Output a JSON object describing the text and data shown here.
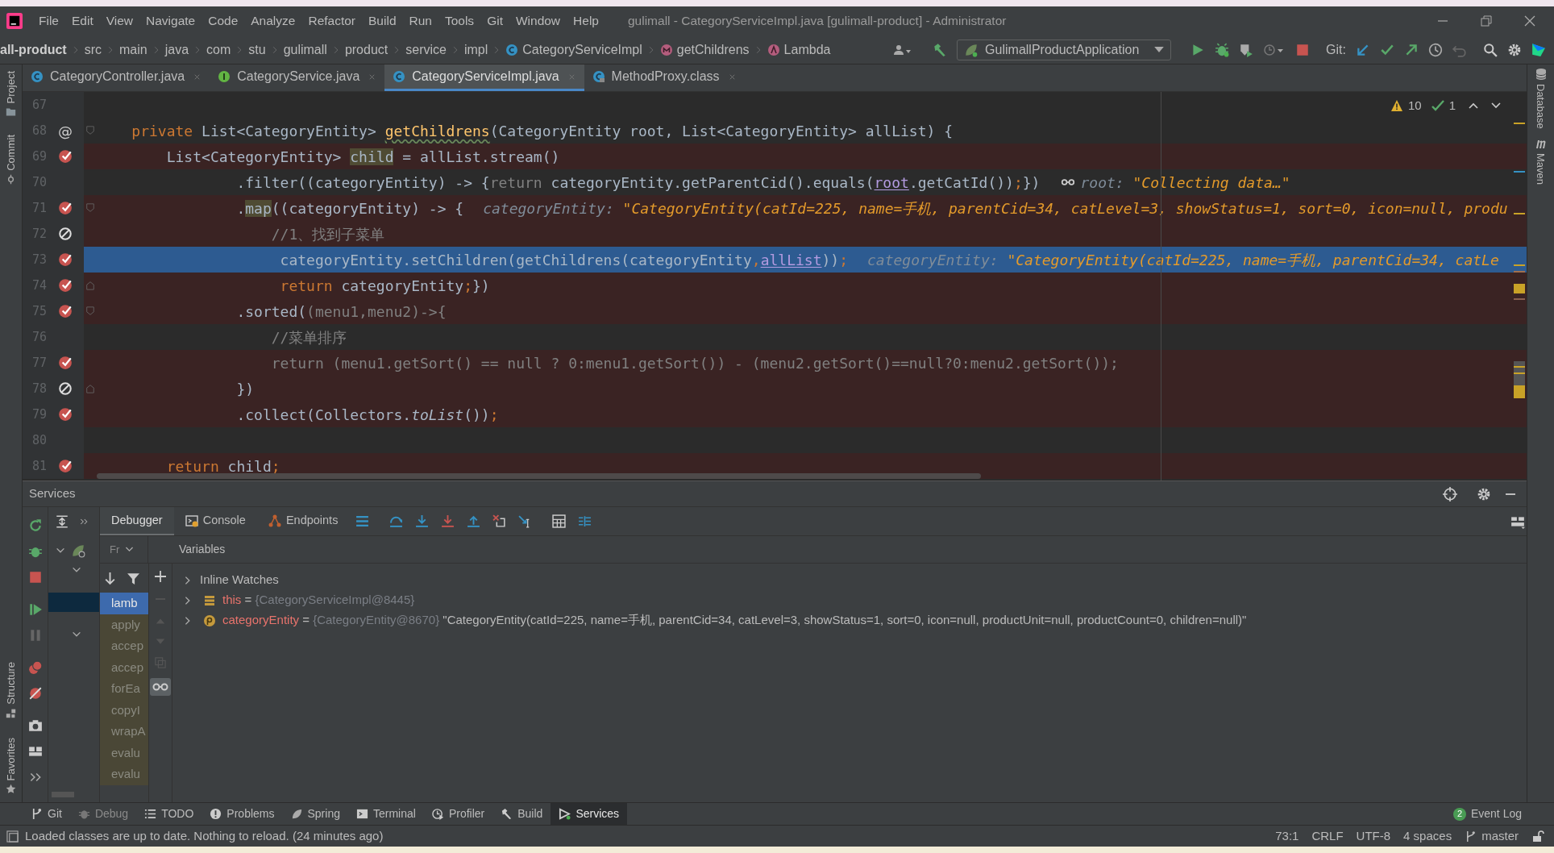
{
  "title_bar": {
    "menu": [
      "File",
      "Edit",
      "View",
      "Navigate",
      "Code",
      "Analyze",
      "Refactor",
      "Build",
      "Run",
      "Tools",
      "Git",
      "Window",
      "Help"
    ],
    "title": "gulimall - CategoryServiceImpl.java [gulimall-product] - Administrator"
  },
  "navigation": {
    "breadcrumbs": [
      {
        "text": "all-product",
        "kind": "module"
      },
      {
        "text": "src",
        "kind": "folder"
      },
      {
        "text": "main",
        "kind": "folder"
      },
      {
        "text": "java",
        "kind": "folder"
      },
      {
        "text": "com",
        "kind": "folder"
      },
      {
        "text": "stu",
        "kind": "folder"
      },
      {
        "text": "gulimall",
        "kind": "folder"
      },
      {
        "text": "product",
        "kind": "folder"
      },
      {
        "text": "service",
        "kind": "folder"
      },
      {
        "text": "impl",
        "kind": "folder"
      },
      {
        "text": "CategoryServiceImpl",
        "kind": "class"
      },
      {
        "text": "getChildrens",
        "kind": "method"
      },
      {
        "text": "Lambda",
        "kind": "lambda"
      }
    ],
    "run_configuration": "GulimallProductApplication",
    "git_label": "Git:"
  },
  "side_tabs": {
    "left_top": [
      "Project",
      "Commit"
    ],
    "left_bottom": [
      "Structure",
      "Favorites"
    ],
    "right": [
      "Database",
      "Maven"
    ]
  },
  "editor_tabs": [
    {
      "label": "CategoryController.java",
      "kind": "class",
      "selected": false
    },
    {
      "label": "CategoryService.java",
      "kind": "interface",
      "selected": false
    },
    {
      "label": "CategoryServiceImpl.java",
      "kind": "class",
      "selected": true
    },
    {
      "label": "MethodProxy.class",
      "kind": "compiled",
      "selected": false
    }
  ],
  "editor": {
    "inspections": {
      "warnings": "10",
      "checks": "1"
    },
    "lines": [
      {
        "number": "67",
        "breakpoint": false,
        "highlighted": false,
        "selected": false,
        "fold_start": false,
        "fold_end": false
      },
      {
        "number": "68",
        "gutter_text": "@",
        "breakpoint": false,
        "highlighted": false,
        "selected": false,
        "fold_start": true,
        "fold_end": false,
        "code": [
          {
            "t": "    private ",
            "kind": "keyword"
          },
          {
            "t": "List<CategoryEntity> ",
            "kind": "plain"
          },
          {
            "t": "getChildrens",
            "kind": "declaration"
          },
          {
            "t": "(CategoryEntity root, List<CategoryEntity> allList) {",
            "kind": "plain"
          }
        ]
      },
      {
        "number": "69",
        "breakpoint": true,
        "muted": false,
        "highlighted": true,
        "selected": false,
        "fold_start": false,
        "fold_end": false,
        "code": [
          {
            "t": "        List<CategoryEntity> ",
            "kind": "plain"
          },
          {
            "t": "child",
            "kind": "usage"
          },
          {
            "t": " = allList.stream()",
            "kind": "plain"
          }
        ]
      },
      {
        "number": "70",
        "breakpoint": false,
        "highlighted": false,
        "selected": false,
        "fold_start": false,
        "fold_end": false,
        "code": [
          {
            "t": "                .filter((categoryEntity) -> {",
            "kind": "plain"
          },
          {
            "t": "return",
            "kind": "dim"
          },
          {
            "t": " categoryEntity.getParentCid().equals(",
            "kind": "plain"
          },
          {
            "t": "root",
            "kind": "link"
          },
          {
            "t": ".getCatId())",
            "kind": "plain"
          },
          {
            "t": ";",
            "kind": "keyword"
          },
          {
            "t": "})",
            "kind": "plain"
          }
        ],
        "hint": {
          "watch": true,
          "label": "root:",
          "value": "\"Collecting data…\""
        }
      },
      {
        "number": "71",
        "breakpoint": true,
        "muted": false,
        "highlighted": true,
        "selected": false,
        "fold_start": true,
        "fold_end": false,
        "code": [
          {
            "t": "                .",
            "kind": "plain"
          },
          {
            "t": "map",
            "kind": "usage"
          },
          {
            "t": "((categoryEntity) -> {",
            "kind": "plain"
          }
        ],
        "hint": {
          "watch": false,
          "label": "categoryEntity:",
          "value": "\"CategoryEntity(catId=225, name=手机, parentCid=34, catLevel=3, showStatus=1, sort=0, icon=null, produ"
        }
      },
      {
        "number": "72",
        "breakpoint": true,
        "muted": true,
        "highlighted": true,
        "selected": false,
        "fold_start": false,
        "fold_end": false,
        "code": [
          {
            "t": "                    //1、找到子菜单",
            "kind": "comment"
          }
        ]
      },
      {
        "number": "73",
        "breakpoint": true,
        "muted": false,
        "highlighted": true,
        "selected": true,
        "fold_start": false,
        "fold_end": false,
        "code": [
          {
            "t": "                     categoryEntity.setChildren(getChildrens(categoryEntity",
            "kind": "plain"
          },
          {
            "t": ",",
            "kind": "keyword"
          },
          {
            "t": "allList",
            "kind": "link"
          },
          {
            "t": "))",
            "kind": "plain"
          },
          {
            "t": ";",
            "kind": "keyword"
          }
        ],
        "hint": {
          "watch": false,
          "label": "categoryEntity:",
          "value": "\"CategoryEntity(catId=225, name=手机, parentCid=34, catLe"
        }
      },
      {
        "number": "74",
        "breakpoint": true,
        "muted": false,
        "highlighted": true,
        "selected": false,
        "fold_start": false,
        "fold_end": true,
        "code": [
          {
            "t": "                     return",
            "kind": "keyword"
          },
          {
            "t": " categoryEntity",
            "kind": "plain"
          },
          {
            "t": ";",
            "kind": "keyword"
          },
          {
            "t": "})",
            "kind": "plain"
          }
        ]
      },
      {
        "number": "75",
        "breakpoint": true,
        "muted": false,
        "highlighted": true,
        "selected": false,
        "fold_start": true,
        "fold_end": false,
        "code": [
          {
            "t": "                .sorted(",
            "kind": "plain"
          },
          {
            "t": "(menu1,menu2)->{",
            "kind": "dim"
          }
        ]
      },
      {
        "number": "76",
        "breakpoint": false,
        "highlighted": false,
        "selected": false,
        "fold_start": false,
        "fold_end": false,
        "code": [
          {
            "t": "                    //菜单排序",
            "kind": "comment"
          }
        ]
      },
      {
        "number": "77",
        "breakpoint": true,
        "muted": false,
        "highlighted": true,
        "selected": false,
        "fold_start": false,
        "fold_end": false,
        "code": [
          {
            "t": "                    return (menu1.getSort() == null ? 0:menu1.getSort()) - (menu2.getSort()==null?0:menu2.getSort());",
            "kind": "dim"
          }
        ]
      },
      {
        "number": "78",
        "breakpoint": true,
        "muted": true,
        "highlighted": true,
        "selected": false,
        "fold_start": false,
        "fold_end": true,
        "code": [
          {
            "t": "                })",
            "kind": "plain"
          }
        ]
      },
      {
        "number": "79",
        "breakpoint": true,
        "muted": false,
        "highlighted": true,
        "selected": false,
        "fold_start": false,
        "fold_end": false,
        "code": [
          {
            "t": "                .collect(Collectors.",
            "kind": "plain"
          },
          {
            "t": "toList",
            "kind": "static"
          },
          {
            "t": "())",
            "kind": "plain"
          },
          {
            "t": ";",
            "kind": "keyword"
          }
        ]
      },
      {
        "number": "80",
        "breakpoint": false,
        "highlighted": false,
        "selected": false,
        "fold_start": false,
        "fold_end": false
      },
      {
        "number": "81",
        "breakpoint": true,
        "muted": false,
        "highlighted": true,
        "selected": false,
        "fold_start": false,
        "fold_end": false,
        "code": [
          {
            "t": "        return",
            "kind": "keyword"
          },
          {
            "t": " child",
            "kind": "plain"
          },
          {
            "t": ";",
            "kind": "keyword"
          }
        ]
      }
    ]
  },
  "services": {
    "title": "Services",
    "debugger_tabs": [
      {
        "label": "Debugger",
        "kind": "debugger",
        "selected": true
      },
      {
        "label": "Console",
        "kind": "console",
        "selected": false
      },
      {
        "label": "Endpoints",
        "kind": "endpoints",
        "selected": false
      }
    ],
    "frames_dropdown": "Fr",
    "variables_title": "Variables",
    "frames": [
      {
        "label": "lamb",
        "selected": true
      },
      {
        "label": "apply",
        "selected": false
      },
      {
        "label": "accep",
        "selected": false
      },
      {
        "label": "accep",
        "selected": false
      },
      {
        "label": "forEa",
        "selected": false
      },
      {
        "label": "copyI",
        "selected": false
      },
      {
        "label": "wrapA",
        "selected": false
      },
      {
        "label": "evalu",
        "selected": false
      },
      {
        "label": "evalu",
        "selected": false
      }
    ],
    "variables": [
      {
        "kind": "group",
        "name": "Inline Watches",
        "expanded": false
      },
      {
        "kind": "field",
        "name": "this",
        "assign": "=",
        "ref": "{CategoryServiceImpl@8445}",
        "expanded": false
      },
      {
        "kind": "parameter",
        "name": "categoryEntity",
        "assign": "=",
        "ref": "{CategoryEntity@8670}",
        "value": "\"CategoryEntity(catId=225, name=手机, parentCid=34, catLevel=3, showStatus=1, sort=0, icon=null, productUnit=null, productCount=0, children=null)\"",
        "expanded": false
      }
    ]
  },
  "tool_windows": [
    {
      "label": "Git",
      "kind": "git",
      "enabled": true,
      "selected": false
    },
    {
      "label": "Debug",
      "kind": "debug",
      "enabled": false,
      "selected": false
    },
    {
      "label": "TODO",
      "kind": "todo",
      "enabled": true,
      "selected": false
    },
    {
      "label": "Problems",
      "kind": "problems",
      "enabled": true,
      "selected": false
    },
    {
      "label": "Spring",
      "kind": "spring",
      "enabled": true,
      "selected": false
    },
    {
      "label": "Terminal",
      "kind": "terminal",
      "enabled": true,
      "selected": false
    },
    {
      "label": "Profiler",
      "kind": "profiler",
      "enabled": true,
      "selected": false
    },
    {
      "label": "Build",
      "kind": "build",
      "enabled": true,
      "selected": false
    },
    {
      "label": "Services",
      "kind": "services",
      "enabled": true,
      "selected": true
    }
  ],
  "event_log": {
    "count": "2",
    "label": "Event Log"
  },
  "status_bar": {
    "message": "Loaded classes are up to date. Nothing to reload. (24 minutes ago)",
    "position": "73:1",
    "line_separator": "CRLF",
    "encoding": "UTF-8",
    "indent": "4 spaces",
    "branch": "master"
  }
}
